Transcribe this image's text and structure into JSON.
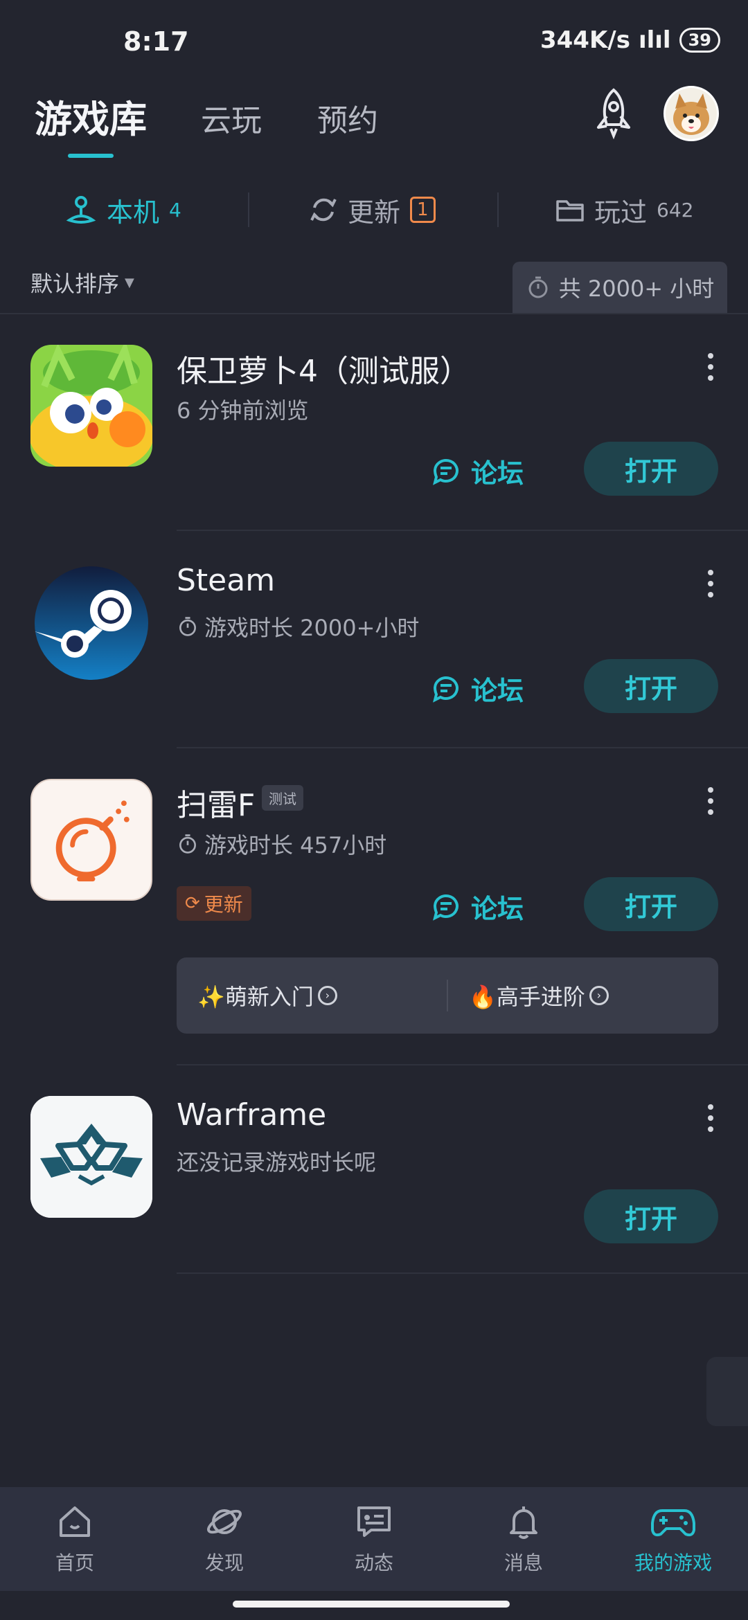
{
  "status": {
    "time": "8:17",
    "speed": "344K/s",
    "battery": "39"
  },
  "header": {
    "tabs": [
      "游戏库",
      "云玩",
      "预约"
    ]
  },
  "subtabs": {
    "local_label": "本机",
    "local_count": "4",
    "update_label": "更新",
    "update_count": "1",
    "played_label": "玩过",
    "played_count": "642"
  },
  "toolbar": {
    "sort_label": "默认排序",
    "total_label": "共 2000+ 小时"
  },
  "games": [
    {
      "name": "保卫萝卜4（测试服）",
      "sub": "6 分钟前浏览",
      "forum": "论坛",
      "open": "打开"
    },
    {
      "name": "Steam",
      "sub": "游戏时长 2000+小时",
      "forum": "论坛",
      "open": "打开"
    },
    {
      "name": "扫雷F",
      "tag": "测试",
      "sub": "游戏时长 457小时",
      "update": "更新",
      "forum": "论坛",
      "open": "打开",
      "guide": [
        "✨萌新入门",
        "🔥高手进阶"
      ]
    },
    {
      "name": "Warframe",
      "sub": "还没记录游戏时长呢",
      "open": "打开"
    }
  ],
  "bottom_nav": [
    "首页",
    "发现",
    "动态",
    "消息",
    "我的游戏"
  ],
  "colors": {
    "accent": "#28c1cf",
    "background": "#23252f",
    "update": "#f08a4b"
  }
}
